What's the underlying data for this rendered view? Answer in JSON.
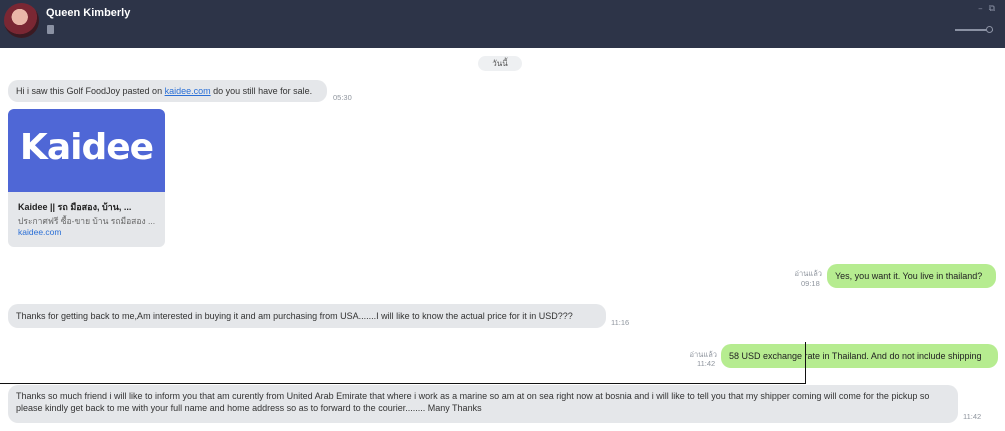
{
  "header": {
    "contact_name": "Queen Kimberly",
    "avatar_icon": "avatar-photo",
    "status_icon": "note-icon",
    "window_controls": [
      "–",
      "⧉"
    ]
  },
  "date_divider": "วันนี้",
  "messages": [
    {
      "direction": "in",
      "text_before": "Hi i saw this Golf FoodJoy pasted on ",
      "link_text": "kaidee.com",
      "text_after": " do you still have for sale.",
      "time": "05:30"
    },
    {
      "direction": "in",
      "type": "link-preview",
      "logo_text": "Kaidee",
      "title": "Kaidee || รถ มือสอง, บ้าน, ...",
      "description": "ประกาศฟรี ซื้อ-ขาย บ้าน รถมือสอง ...",
      "domain": "kaidee.com"
    },
    {
      "direction": "out",
      "text": "Yes, you want it. You live in thailand?",
      "read_label": "อ่านแล้ว",
      "time": "09:18"
    },
    {
      "direction": "in",
      "text": "Thanks for getting back to me,Am interested in buying it and am purchasing from USA.......I will like to know the actual price for it in USD???",
      "time": "11:16"
    },
    {
      "direction": "out",
      "text": "58 USD exchange rate in Thailand. And do not include shipping",
      "read_label": "อ่านแล้ว",
      "time": "11:42"
    },
    {
      "direction": "in",
      "text": "Thanks so much friend i will like to inform you that am curently from United Arab Emirate that where i work as a marine so am at on sea right now at bosnia and i will like to tell you that my shipper coming will come for the pickup so please kindly get back to me with your full name and home address so as to forward to the courier........ Many Thanks",
      "time": "11:42"
    }
  ],
  "colors": {
    "header_bg": "#2d3448",
    "incoming_bubble": "#e5e7ea",
    "outgoing_bubble": "#b6ec90",
    "link": "#2a6fd6",
    "card_banner": "#4f67d6"
  }
}
